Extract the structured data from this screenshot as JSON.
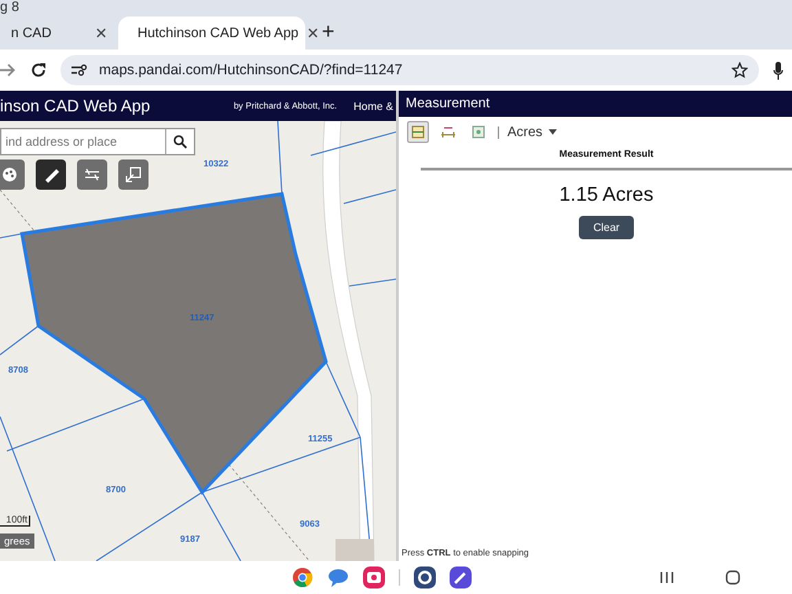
{
  "browser": {
    "window_title": "g 8",
    "tabs": [
      {
        "title": "n CAD",
        "selected": false,
        "close": "✕"
      },
      {
        "title": "Hutchinson CAD Web App",
        "selected": true,
        "close": "✕"
      }
    ],
    "new_tab": "+",
    "url": "maps.pandai.com/HutchinsonCAD/?find=11247"
  },
  "app": {
    "title": "inson CAD Web App",
    "subtitle": "by Pritchard & Abbott, Inc.",
    "nav": "Home &"
  },
  "map": {
    "search": {
      "placeholder": "ind address or place"
    },
    "tools": [
      {
        "kind": "layers",
        "selected": false
      },
      {
        "kind": "measure",
        "selected": true
      },
      {
        "kind": "compare",
        "selected": false
      },
      {
        "kind": "export",
        "selected": false
      }
    ],
    "parcels": [
      {
        "label": "10322",
        "selected": false
      },
      {
        "label": "11247",
        "selected": true
      },
      {
        "label": "8708",
        "selected": false
      },
      {
        "label": "11255",
        "selected": false
      },
      {
        "label": "8700",
        "selected": false
      },
      {
        "label": "9063",
        "selected": false
      },
      {
        "label": "9187",
        "selected": false
      }
    ],
    "scale": "100ft",
    "units_badge": "grees"
  },
  "panel": {
    "title": "Measurement",
    "tools": [
      {
        "kind": "area",
        "selected": true
      },
      {
        "kind": "distance",
        "selected": false
      },
      {
        "kind": "location",
        "selected": false
      }
    ],
    "unit": "Acres",
    "result_heading": "Measurement Result",
    "result": "1.15 Acres",
    "clear": "Clear",
    "hint": "Press **CTRL** to enable snapping"
  },
  "taskbar": {
    "apps": [
      {
        "kind": "chrome"
      },
      {
        "kind": "messages"
      },
      {
        "kind": "camera"
      },
      {
        "kind": "settings"
      },
      {
        "kind": "notes"
      }
    ],
    "nav": [
      {
        "kind": "recents"
      },
      {
        "kind": "home"
      }
    ]
  }
}
